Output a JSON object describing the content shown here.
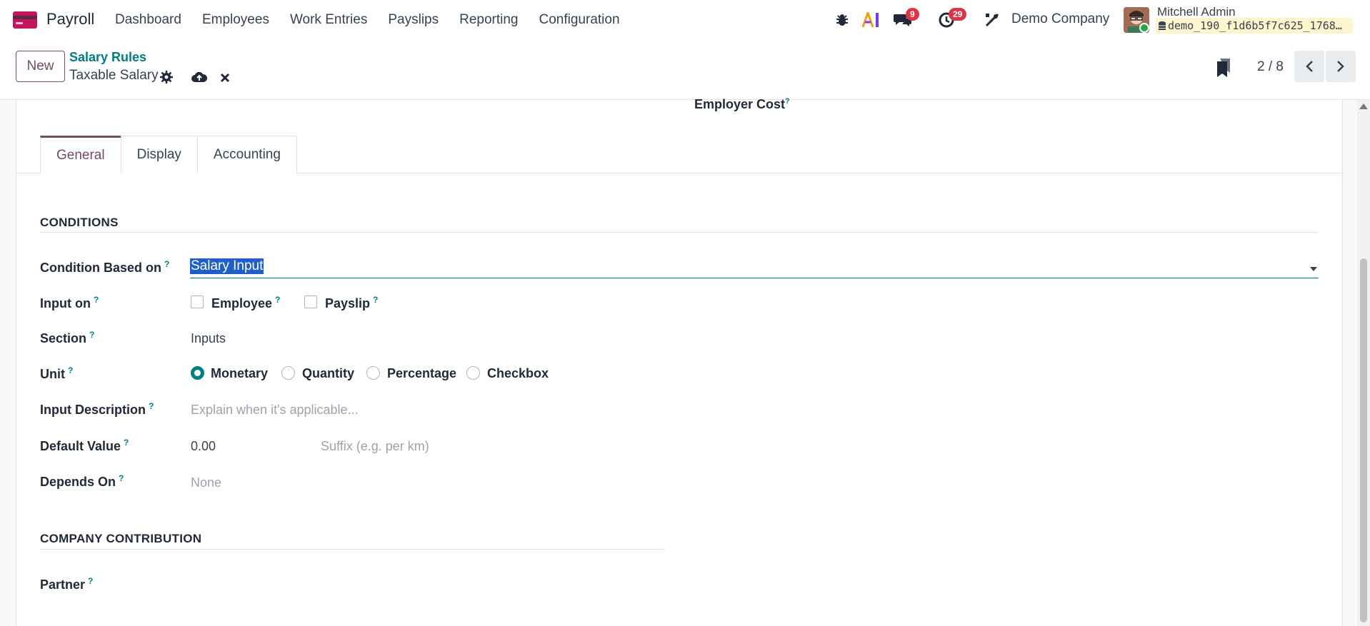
{
  "app": {
    "name": "Payroll"
  },
  "menu": [
    "Dashboard",
    "Employees",
    "Work Entries",
    "Payslips",
    "Reporting",
    "Configuration"
  ],
  "systray": {
    "messages_count": "9",
    "activities_count": "29",
    "company": "Demo Company",
    "user_name": "Mitchell Admin",
    "database": "demo_190_f1d6b5f7c625_1768…"
  },
  "control": {
    "new_label": "New",
    "breadcrumb": "Salary Rules",
    "record_title": "Taxable Salary",
    "pager": "2 / 8"
  },
  "form": {
    "employer_cost_label": "Employer Cost",
    "tabs": [
      "General",
      "Display",
      "Accounting"
    ],
    "conditions_title": "CONDITIONS",
    "fields": {
      "condition_based_on": {
        "label": "Condition Based on",
        "value": "Salary Input"
      },
      "input_on": {
        "label": "Input on",
        "employee": "Employee",
        "payslip": "Payslip"
      },
      "section": {
        "label": "Section",
        "value": "Inputs"
      },
      "unit": {
        "label": "Unit",
        "options": [
          "Monetary",
          "Quantity",
          "Percentage",
          "Checkbox"
        ],
        "selected": "Monetary"
      },
      "input_description": {
        "label": "Input Description",
        "placeholder": "Explain when it's applicable..."
      },
      "default_value": {
        "label": "Default Value",
        "value": "0.00",
        "suffix_placeholder": "Suffix (e.g. per km)"
      },
      "depends_on": {
        "label": "Depends On",
        "placeholder": "None"
      }
    },
    "company_contribution_title": "COMPANY CONTRIBUTION",
    "partner": {
      "label": "Partner"
    },
    "help_mark": "?"
  },
  "colors": {
    "brand": "#714b67",
    "accent": "#017e84",
    "badge": "#dc3545",
    "selection": "#1e5fc9"
  }
}
